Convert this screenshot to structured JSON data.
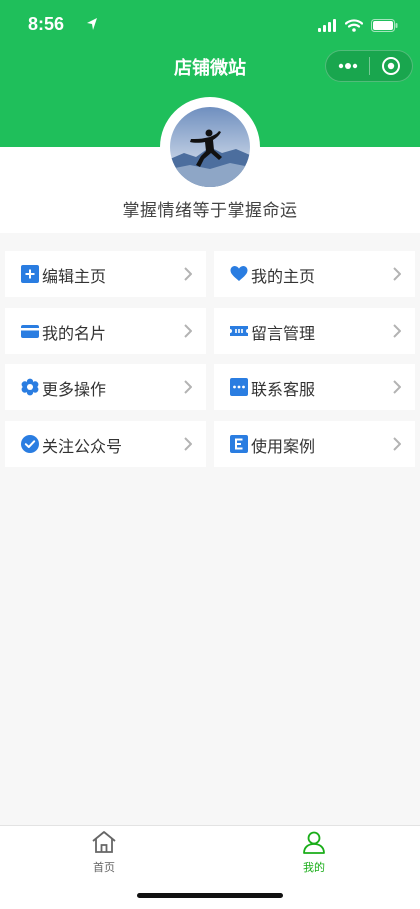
{
  "status_bar": {
    "time": "8:56"
  },
  "nav": {
    "title": "店铺微站"
  },
  "profile": {
    "name": "掌握情绪等于掌握命运"
  },
  "menu": [
    {
      "label": "编辑主页",
      "icon": "edit-square-icon"
    },
    {
      "label": "我的主页",
      "icon": "heart-icon"
    },
    {
      "label": "我的名片",
      "icon": "card-icon"
    },
    {
      "label": "留言管理",
      "icon": "ticket-icon"
    },
    {
      "label": "更多操作",
      "icon": "flower-gear-icon"
    },
    {
      "label": "联系客服",
      "icon": "chat-dots-icon"
    },
    {
      "label": "关注公众号",
      "icon": "check-circle-icon"
    },
    {
      "label": "使用案例",
      "icon": "e-square-icon"
    }
  ],
  "tabbar": {
    "home": {
      "label": "首页",
      "icon": "home-icon"
    },
    "mine": {
      "label": "我的",
      "icon": "user-icon"
    }
  },
  "colors": {
    "brand_green": "#1fbf5b",
    "icon_blue": "#2a7de1",
    "tab_inactive": "#666666",
    "tab_active": "#1aad19"
  }
}
